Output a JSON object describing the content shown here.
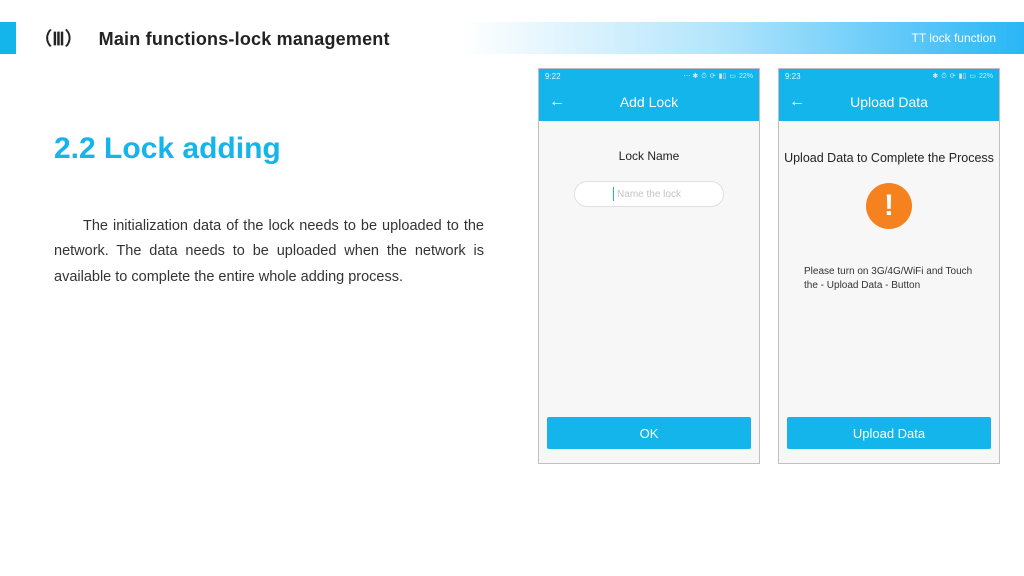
{
  "header": {
    "section_marker": "（Ⅲ）",
    "title": "Main functions-lock management",
    "right_label": "TT lock function"
  },
  "section": {
    "heading": "2.2 Lock adding",
    "body": "The initialization data of the lock needs to be uploaded to the network. The data needs to be uploaded when the network is available to complete the entire whole adding process."
  },
  "phone_left": {
    "status_time": "9:22",
    "status_battery": "22%",
    "appbar_title": "Add Lock",
    "field_label": "Lock Name",
    "input_placeholder": "Name the lock",
    "primary_button": "OK"
  },
  "phone_right": {
    "status_time": "9:23",
    "status_battery": "22%",
    "appbar_title": "Upload Data",
    "headline": "Upload Data to Complete the Process",
    "warn_glyph": "!",
    "hint": "Please turn on 3G/4G/WiFi and Touch the - Upload Data - Button",
    "primary_button": "Upload Data"
  }
}
